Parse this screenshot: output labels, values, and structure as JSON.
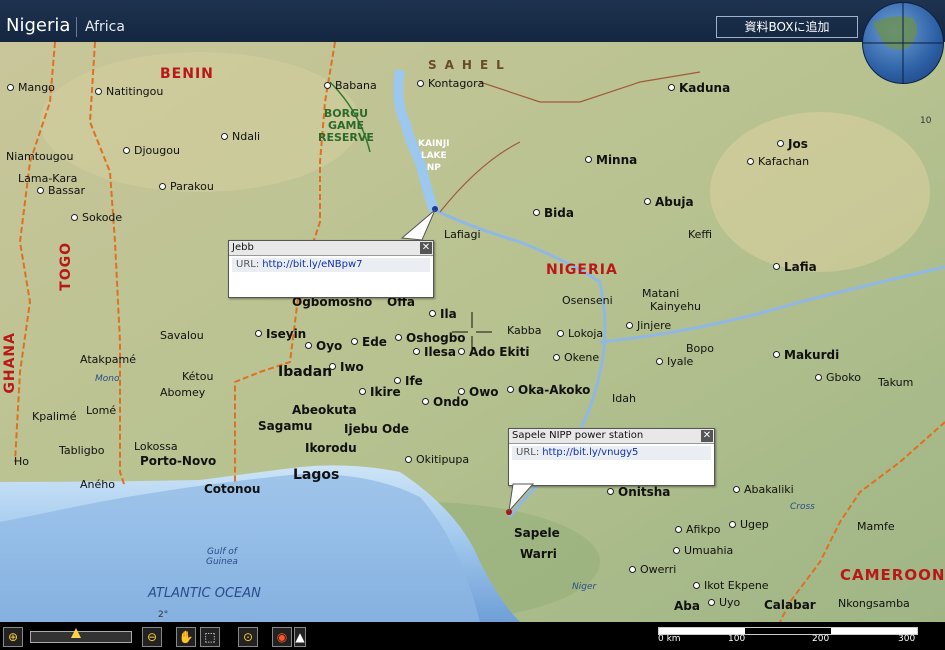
{
  "header": {
    "title": "Nigeria",
    "region": "Africa",
    "add_box_label": "資料BOXに追加"
  },
  "map": {
    "countries": [
      "BENIN",
      "NIGERIA",
      "TOGO",
      "GHANA",
      "CAMEROON"
    ],
    "parks": [
      "BORGU\nGAME\nRESERVE",
      "KAINJI\nLAKE\nNP"
    ],
    "region_label": "SAHEL",
    "water_labels": [
      "Gulf of\nGuinea",
      "ATLANTIC OCEAN",
      "Niger",
      "Mono",
      "Cross"
    ],
    "places": [
      "Mango",
      "Natitingou",
      "Babana",
      "Kontagora",
      "Kaduna",
      "Ndali",
      "Djougou",
      "Niamtougou",
      "Lama-Kara",
      "Bassar",
      "Sokode",
      "Parakou",
      "Bida",
      "Minna",
      "Abuja",
      "Jos",
      "Kafachan",
      "Keffi",
      "Lafiagi",
      "Lafia",
      "Ogbomosho",
      "Offa",
      "Ila",
      "Osenseni",
      "Matani",
      "Kainyehu",
      "Jinjere",
      "Iseyin",
      "Oyo",
      "Ede",
      "Oshogbo",
      "Ilesa",
      "Kabba",
      "Lokoja",
      "Savalou",
      "Atakpamé",
      "Ibadan",
      "Iwo",
      "Ado Ekiti",
      "Okene",
      "Bopo",
      "Iyale",
      "Makurdi",
      "Kétou",
      "Abomey",
      "Ikire",
      "Ife",
      "Owo",
      "Oka-Akoko",
      "Gboko",
      "Takum",
      "Kpalimé",
      "Lomé",
      "Abeokuta",
      "Ondo",
      "Idah",
      "Sagamu",
      "Ijebu Ode",
      "Tabligbo",
      "Lokossa",
      "Ikorodu",
      "Okitipupa",
      "Porto-Novo",
      "Lagos",
      "Ho",
      "Aného",
      "Cotonou",
      "Abakaliki",
      "Onitsha",
      "Sapele",
      "Afikpo",
      "Ugep",
      "Mamfe",
      "Warri",
      "Umuahia",
      "Owerri",
      "Ikot Ekpene",
      "Aba",
      "Uyo",
      "Calabar",
      "Nkongsamba",
      "Jebb",
      "Sapele NIPP power station"
    ],
    "longitude_marks": [
      "2°",
      "10"
    ]
  },
  "popups": [
    {
      "title": "Jebb",
      "url_label": "URL:",
      "url": "http://bit.ly/eNBpw7"
    },
    {
      "title": "Sapele NIPP power station",
      "url_label": "URL:",
      "url": "http://bit.ly/vnugy5"
    }
  ],
  "toolbar": {
    "scale_labels": [
      "0 km",
      "100",
      "200",
      "300"
    ],
    "icons": [
      "zoom-in-icon",
      "zoom-out-icon",
      "hand-pan-icon",
      "select-icon",
      "target-icon",
      "globe-icon"
    ]
  },
  "colors": {
    "header": "#1a2e4a",
    "country_label": "#b81818",
    "sea": "#a8cdf0",
    "land": "#c7c79a"
  }
}
